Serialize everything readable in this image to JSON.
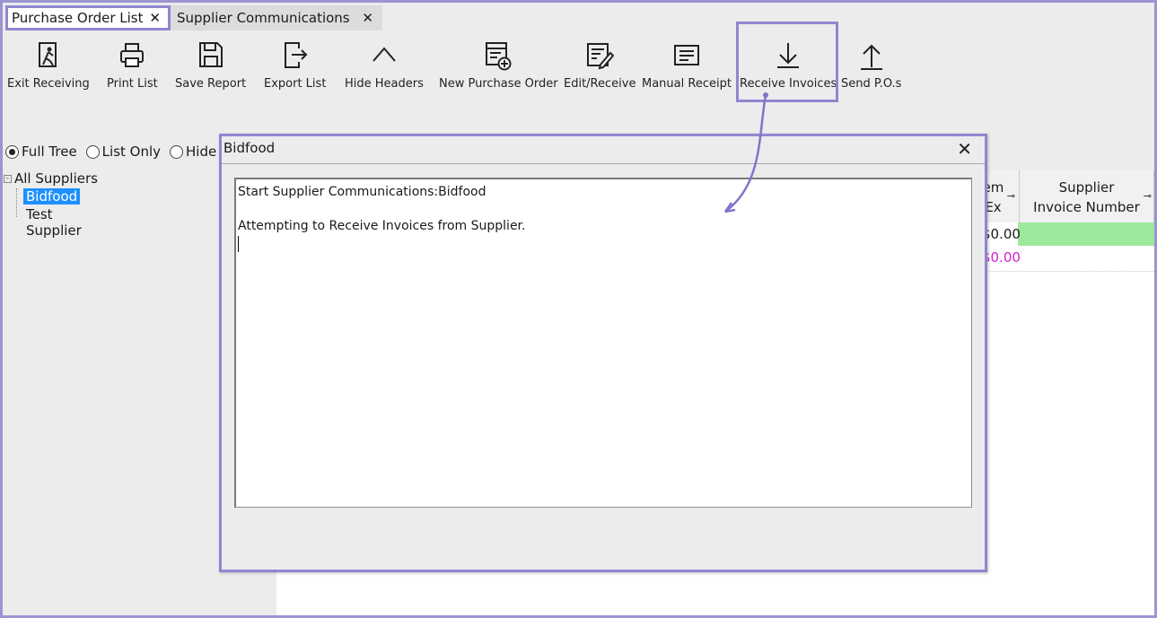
{
  "tabs": [
    {
      "label": "Purchase Order List",
      "active": true
    },
    {
      "label": "Supplier Communications",
      "active": false
    }
  ],
  "tab_close_glyph": "✕",
  "toolbar": [
    {
      "label": "Exit Receiving",
      "icon": "exit-icon"
    },
    {
      "label": "Print List",
      "icon": "printer-icon"
    },
    {
      "label": "Save Report",
      "icon": "save-icon"
    },
    {
      "label": "Export List",
      "icon": "export-icon"
    },
    {
      "label": "Hide Headers",
      "icon": "chevron-up-icon"
    },
    {
      "label": "New Purchase Order",
      "icon": "new-order-icon"
    },
    {
      "label": "Edit/Receive",
      "icon": "edit-icon"
    },
    {
      "label": "Manual Receipt",
      "icon": "receipt-icon"
    },
    {
      "label": "Receive Invoices",
      "icon": "download-icon"
    },
    {
      "label": "Send P.O.s",
      "icon": "upload-icon"
    }
  ],
  "view_options": [
    {
      "label": "Full Tree",
      "selected": true
    },
    {
      "label": "List Only",
      "selected": false
    },
    {
      "label": "Hide",
      "selected": false
    }
  ],
  "tree": {
    "root": "All Suppliers",
    "expander": "-",
    "children": [
      {
        "label": "Bidfood",
        "selected": true
      },
      {
        "label": "Test Supplier",
        "selected": false
      }
    ]
  },
  "grid": {
    "headers": [
      {
        "line1": "em",
        "line2": "Ex"
      },
      {
        "line1": "Supplier",
        "line2": "Invoice Number"
      }
    ],
    "pin_glyph": "⊸",
    "rows": [
      {
        "value": "$0.00",
        "color": "#000000"
      },
      {
        "value": "$0.00",
        "color": "#d020d0"
      }
    ]
  },
  "dialog": {
    "title": "Bidfood",
    "close_glyph": "✕",
    "log_lines": [
      "Start Supplier Communications:Bidfood",
      "",
      "Attempting to Receive Invoices from Supplier."
    ]
  },
  "colors": {
    "highlight": "#8f87d0",
    "selection": "#1e90ff",
    "row_green": "#9de89a"
  }
}
